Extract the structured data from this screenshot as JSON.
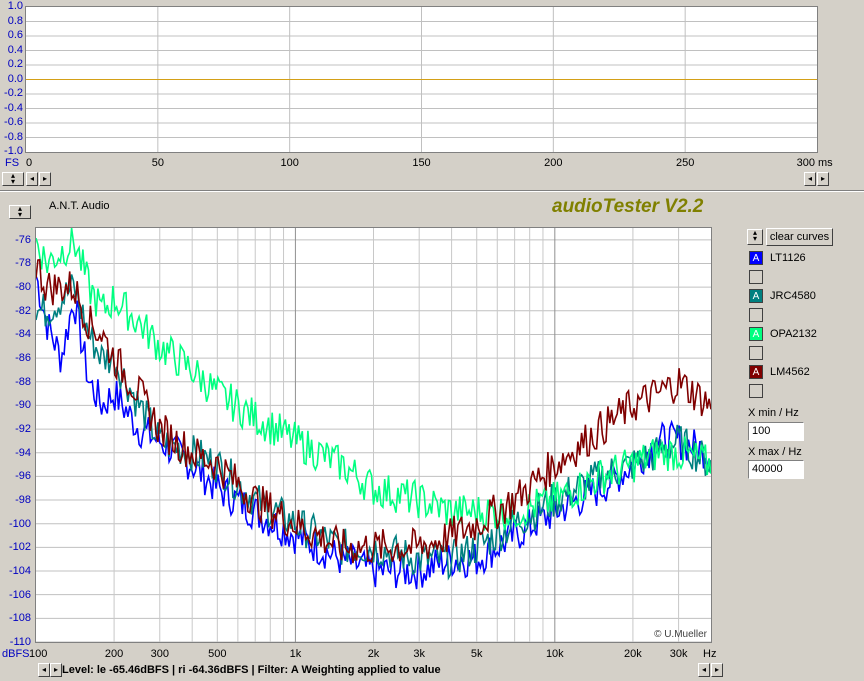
{
  "time_plot": {
    "y_ticks": [
      "1.0",
      "0.8",
      "0.6",
      "0.4",
      "0.2",
      "0.0",
      "-0.2",
      "-0.4",
      "-0.6",
      "-0.8",
      "-1.0"
    ],
    "y_unit": "FS",
    "x_ticks": [
      "0",
      "50",
      "100",
      "150",
      "200",
      "250",
      "300"
    ],
    "x_unit": "ms",
    "trace_color": "#d4a017"
  },
  "header": {
    "brand_label": "A.N.T. Audio",
    "app_title": "audioTester V2.2",
    "title_color": "#808000"
  },
  "spectrum_plot": {
    "y_ticks": [
      "-76",
      "-78",
      "-80",
      "-82",
      "-84",
      "-86",
      "-88",
      "-90",
      "-92",
      "-94",
      "-96",
      "-98",
      "-100",
      "-102",
      "-104",
      "-106",
      "-108",
      "-110"
    ],
    "y_unit": "dBFS",
    "x_ticks": [
      "100",
      "200",
      "300",
      "500",
      "1k",
      "2k",
      "3k",
      "5k",
      "10k",
      "20k",
      "30k"
    ],
    "x_unit": "Hz",
    "copyright": "© U.Mueller"
  },
  "legend": {
    "clear_label": "clear curves",
    "items": [
      {
        "label": "LT1126",
        "color": "#0000ff",
        "marker": "A"
      },
      {
        "label": "JRC4580",
        "color": "#008080",
        "marker": "A"
      },
      {
        "label": "OPA2132",
        "color": "#00ff80",
        "marker": "A"
      },
      {
        "label": "LM4562",
        "color": "#800000",
        "marker": "A"
      }
    ],
    "xmin_label": "X min / Hz",
    "xmin_value": "100",
    "xmax_label": "X max / Hz",
    "xmax_value": "40000"
  },
  "status": {
    "text": "Level: le -65.46dBFS | ri -64.36dBFS | Filter: A Weighting applied to value"
  },
  "chart_data": {
    "type": "line",
    "xscale": "log",
    "xlim": [
      100,
      40000
    ],
    "ylim": [
      -110,
      -75
    ],
    "ylabel": "dBFS",
    "xlabel": "Hz",
    "grid": true,
    "legend_position": "right",
    "series": [
      {
        "name": "LT1126",
        "color": "#0000ff",
        "x": [
          100,
          110,
          125,
          140,
          160,
          180,
          200,
          250,
          300,
          400,
          500,
          700,
          1000,
          1500,
          2000,
          3000,
          4000,
          5000,
          7000,
          10000,
          15000,
          20000,
          25000,
          30000,
          40000
        ],
        "y": [
          -79,
          -83,
          -86,
          -81,
          -88,
          -90,
          -89,
          -92,
          -93,
          -95,
          -97,
          -99,
          -101,
          -103,
          -104,
          -104,
          -103,
          -103,
          -101,
          -99,
          -97,
          -95,
          -93,
          -93,
          -94
        ]
      },
      {
        "name": "JRC4580",
        "color": "#008080",
        "x": [
          100,
          110,
          125,
          140,
          160,
          180,
          200,
          250,
          300,
          400,
          500,
          700,
          1000,
          1500,
          2000,
          3000,
          4000,
          5000,
          7000,
          10000,
          15000,
          20000,
          25000,
          30000,
          40000
        ],
        "y": [
          -82,
          -82,
          -81,
          -80,
          -84,
          -86,
          -86,
          -90,
          -93,
          -94,
          -95,
          -98,
          -100,
          -102,
          -102,
          -103,
          -103,
          -102,
          -100,
          -98,
          -96,
          -95,
          -94,
          -93,
          -95
        ]
      },
      {
        "name": "OPA2132",
        "color": "#00ff80",
        "x": [
          100,
          110,
          125,
          140,
          160,
          180,
          200,
          250,
          300,
          400,
          500,
          700,
          1000,
          1500,
          2000,
          3000,
          4000,
          5000,
          7000,
          10000,
          15000,
          20000,
          25000,
          30000,
          40000
        ],
        "y": [
          -76,
          -78,
          -77,
          -76,
          -80,
          -82,
          -81,
          -83,
          -85,
          -87,
          -89,
          -91,
          -93,
          -95,
          -97,
          -98,
          -99,
          -99,
          -99,
          -98,
          -96,
          -95,
          -94,
          -94,
          -95
        ]
      },
      {
        "name": "LM4562",
        "color": "#800000",
        "x": [
          100,
          110,
          125,
          140,
          160,
          180,
          200,
          250,
          300,
          400,
          500,
          700,
          1000,
          1500,
          2000,
          3000,
          4000,
          5000,
          7000,
          10000,
          15000,
          20000,
          25000,
          30000,
          40000
        ],
        "y": [
          -78,
          -80,
          -80,
          -80,
          -83,
          -84,
          -86,
          -89,
          -92,
          -94,
          -95,
          -98,
          -100,
          -102,
          -102,
          -102,
          -101,
          -100,
          -98,
          -95,
          -92,
          -90,
          -89,
          -88,
          -90
        ]
      }
    ]
  }
}
